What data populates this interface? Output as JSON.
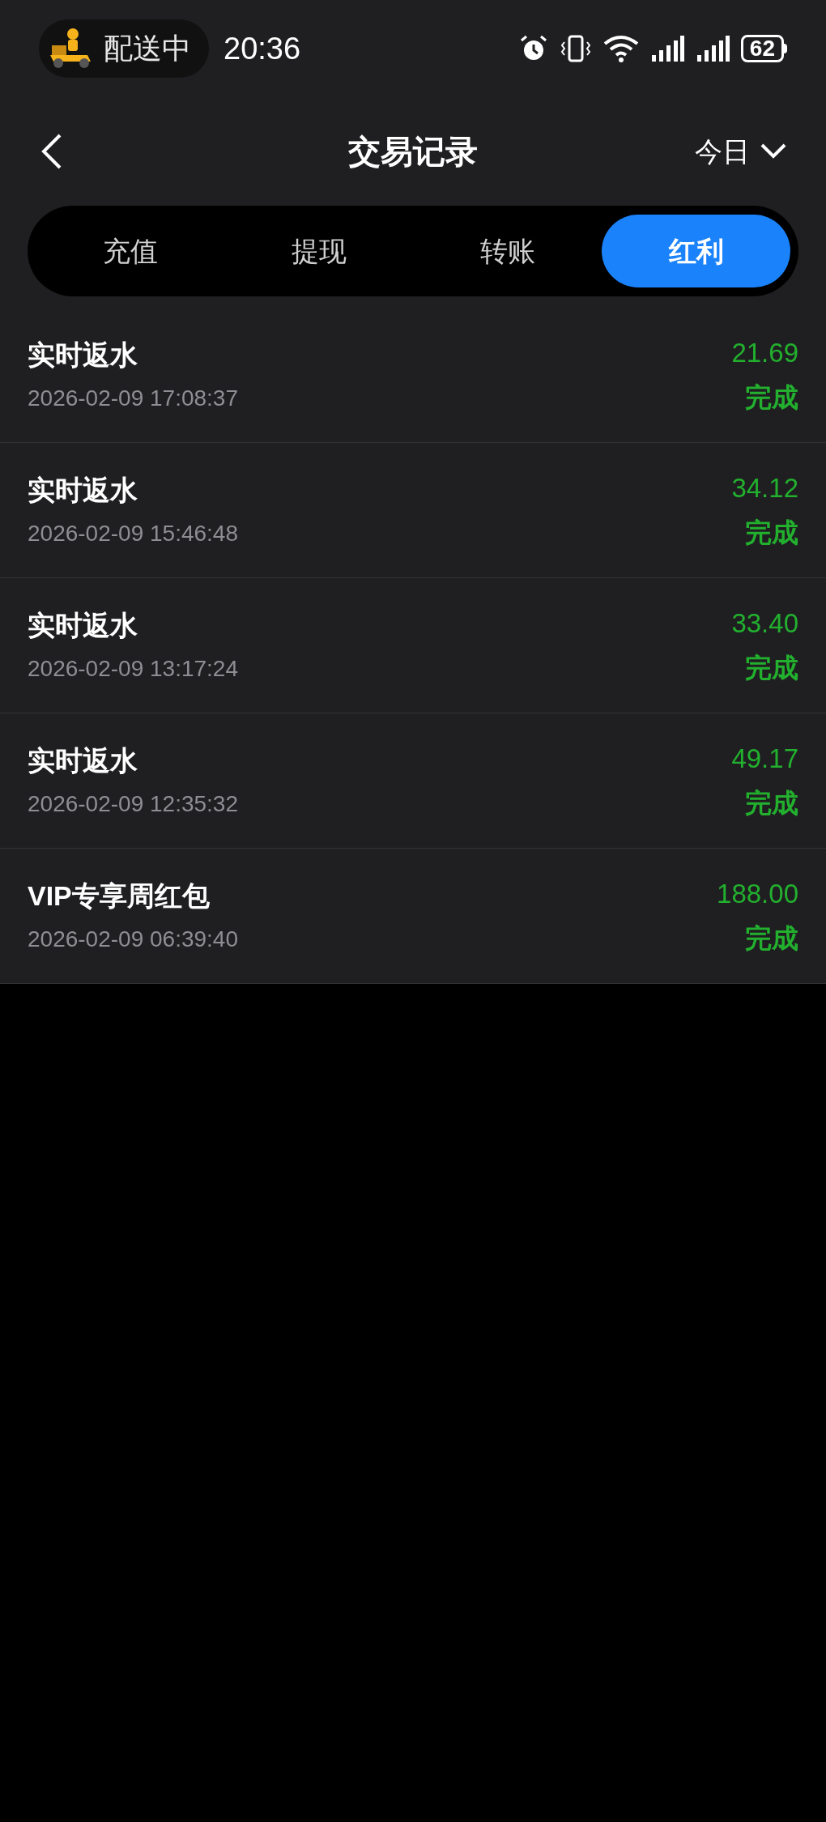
{
  "status_bar": {
    "activity": "配送中",
    "time": "20:36",
    "battery": "62"
  },
  "header": {
    "title": "交易记录",
    "period": "今日"
  },
  "tabs": [
    {
      "label": "充值",
      "selected": false
    },
    {
      "label": "提现",
      "selected": false
    },
    {
      "label": "转账",
      "selected": false
    },
    {
      "label": "红利",
      "selected": true
    }
  ],
  "records": [
    {
      "name": "实时返水",
      "time": "2026-02-09 17:08:37",
      "amount": "21.69",
      "status": "完成"
    },
    {
      "name": "实时返水",
      "time": "2026-02-09 15:46:48",
      "amount": "34.12",
      "status": "完成"
    },
    {
      "name": "实时返水",
      "time": "2026-02-09 13:17:24",
      "amount": "33.40",
      "status": "完成"
    },
    {
      "name": "实时返水",
      "time": "2026-02-09 12:35:32",
      "amount": "49.17",
      "status": "完成"
    },
    {
      "name": "VIP专享周红包",
      "time": "2026-02-09 06:39:40",
      "amount": "188.00",
      "status": "完成"
    }
  ]
}
